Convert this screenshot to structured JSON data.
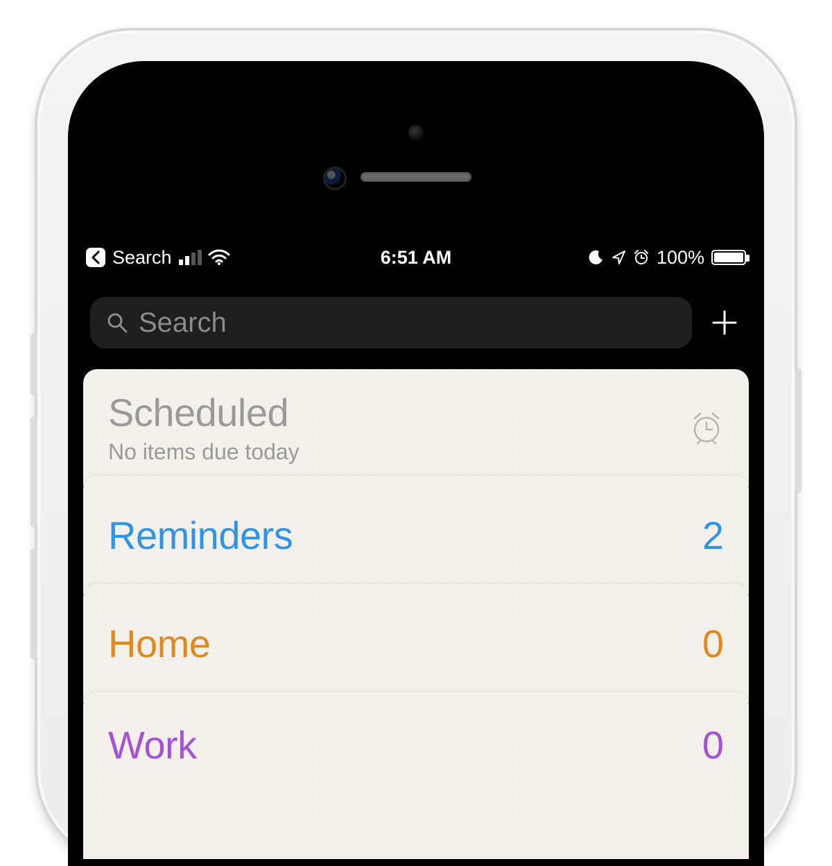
{
  "status_bar": {
    "back_label": "Search",
    "time": "6:51 AM",
    "battery_pct": "100%",
    "signal_bars_on": 2
  },
  "search": {
    "placeholder": "Search"
  },
  "scheduled": {
    "title": "Scheduled",
    "subtitle": "No items due today"
  },
  "lists": [
    {
      "name": "Reminders",
      "count": "2",
      "color": "#2f94e8"
    },
    {
      "name": "Home",
      "count": "0",
      "color": "#e08a1d"
    },
    {
      "name": "Work",
      "count": "0",
      "color": "#a451d6"
    }
  ]
}
